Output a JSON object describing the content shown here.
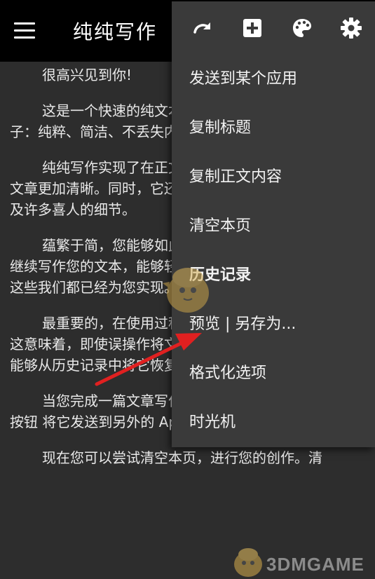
{
  "app": {
    "title": "纯纯写作"
  },
  "menu": {
    "toolbar": [
      {
        "icon": "redo-icon"
      },
      {
        "icon": "add-box-icon"
      },
      {
        "icon": "palette-icon"
      },
      {
        "icon": "gear-icon"
      }
    ],
    "items": [
      {
        "label": "发送到某个应用"
      },
      {
        "label": "复制标题"
      },
      {
        "label": "复制正文内容"
      },
      {
        "label": "清空本页"
      },
      {
        "label": "历史记录"
      },
      {
        "label": "预览 | 另存为..."
      },
      {
        "label": "格式化选项"
      },
      {
        "label": "时光机"
      }
    ]
  },
  "editor": {
    "paragraphs": [
      "很高兴见到你!",
      "这是一个快速的纯文本编辑器，能够回到原本的样子：纯粹、简洁、不丢失内容、具备良好的写作体验。",
      "纯纯写作实现了在正文内加入段间距，它能够使您的文章更加清晰。同时，它还实现了顺滑地唤起软键盘，以及许多喜人的细节。",
      "蕴繁于简，您能够如此简单而又能够随时随地中断和继续写作您的文本，能够轻易、快速地分享到其它 App，这些我们都已经为您实现。",
      "最重要的，在使用过程中，您的内容永远不会丢失，这意味着，即使误操作将文本删除，或瞬间断电，您仍然能够从历史记录中将它恢复。",
      "当您完成一篇文章写作之后，可以选择 右上角发送按钮 将它发送到另外的 App，或开启新篇章。",
      "现在您可以尝试清空本页，进行您的创作。清"
    ]
  },
  "watermark": {
    "text": "3DMGAME"
  }
}
